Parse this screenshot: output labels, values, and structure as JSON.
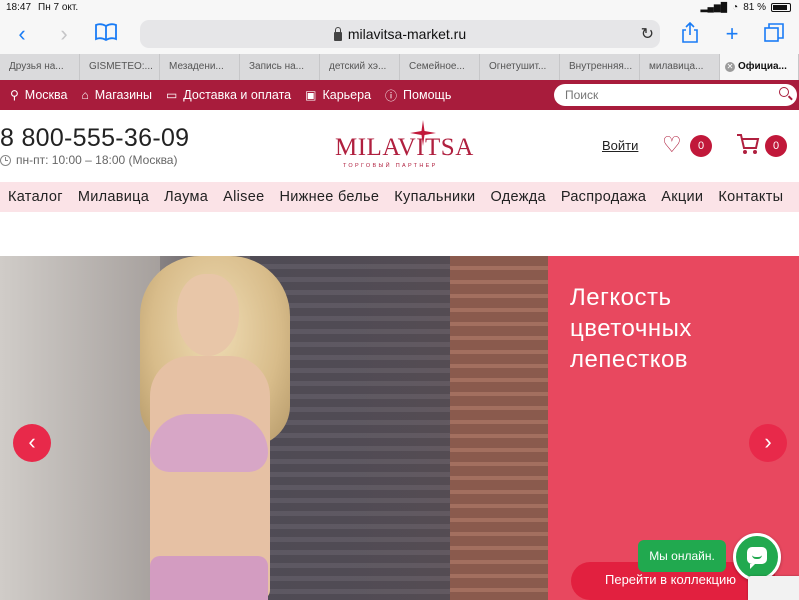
{
  "status_bar": {
    "time": "18:47",
    "date": "Пн 7 окт.",
    "battery": "81 %"
  },
  "browser": {
    "url": "milavitsa-market.ru",
    "tabs": [
      "Друзья на...",
      "GISMETEO:...",
      "Мезадени...",
      "Запись на...",
      "детский хэ...",
      "Семейное...",
      "Огнетушит...",
      "Внутренняя...",
      "милавица...",
      "Официа..."
    ]
  },
  "topnav": {
    "city": "Москва",
    "stores": "Магазины",
    "delivery": "Доставка и оплата",
    "career": "Карьера",
    "help": "Помощь",
    "search_placeholder": "Поиск"
  },
  "header": {
    "phone": "8 800-555-36-09",
    "hours": "пн-пт: 10:00 – 18:00 (Москва)",
    "logo_text": "MILAVITSA",
    "logo_tagline": "ТОРГОВЫЙ ПАРТНЕР",
    "login": "Войти",
    "favorites_count": "0",
    "cart_count": "0"
  },
  "categories": [
    "Каталог",
    "Милавица",
    "Лаума",
    "Alisee",
    "Нижнее белье",
    "Купальники",
    "Одежда",
    "Распродажа",
    "Акции",
    "Контакты"
  ],
  "hero": {
    "title": "Легкость цветочных лепестков",
    "cta": "Перейти в коллекцию",
    "prev_arrow": "‹",
    "next_arrow": "›"
  },
  "chat": {
    "online_label": "Мы онлайн."
  },
  "colors": {
    "brand_red": "#a81c3c",
    "promo_pink": "#e8485f",
    "accent": "#e2203f",
    "chat_green": "#21a94f",
    "category_bg": "#fbe3e7"
  }
}
